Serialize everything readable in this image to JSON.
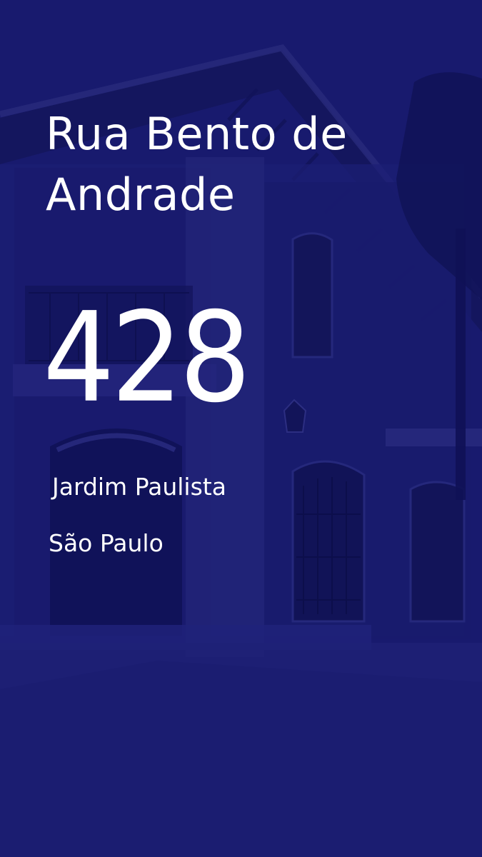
{
  "address": {
    "street": "Rua Bento de Andrade",
    "number": "428",
    "neighborhood": "Jardim Paulista",
    "city": "São Paulo"
  },
  "colors": {
    "overlay": "#16186a",
    "text": "#ffffff"
  },
  "background": {
    "image": "house-photo-with-blue-overlay"
  }
}
